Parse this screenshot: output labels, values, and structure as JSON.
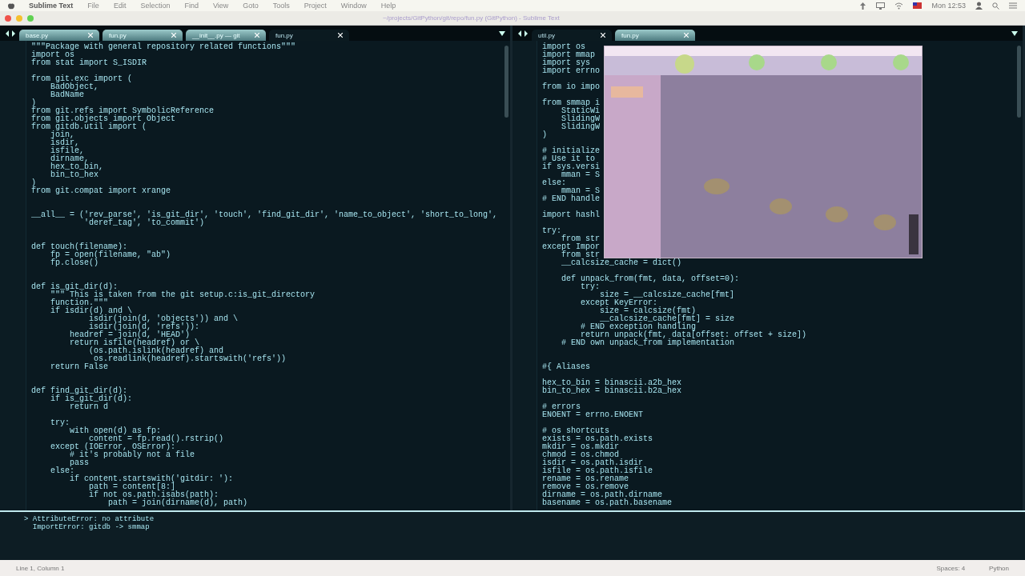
{
  "menu_bar": {
    "app_name": "Sublime Text",
    "menus": [
      "File",
      "Edit",
      "Selection",
      "Find",
      "View",
      "Goto",
      "Tools",
      "Project",
      "Window",
      "Help"
    ],
    "clock": "Mon 12:53"
  },
  "title_bar": {
    "title": "~/projects/GitPython/git/repo/fun.py (GitPython) - Sublime Text"
  },
  "left_pane": {
    "tabs": [
      {
        "label": "base.py",
        "selected": false
      },
      {
        "label": "fun.py",
        "selected": false
      },
      {
        "label": "__init__.py — git",
        "selected": false
      },
      {
        "label": "fun.py",
        "selected": true
      }
    ],
    "code": [
      {
        "kind": "flush",
        "lines": [
          "\"\"\"Package with general repository related functions\"\"\"",
          "import os",
          "from stat import S_ISDIR"
        ]
      },
      {
        "kind": "spaced",
        "lines": [
          "from git.exc import (",
          "    BadObject,",
          "    BadName",
          ")",
          "from git.refs import SymbolicReference",
          "from git.objects import Object",
          "from gitdb.util import (",
          "    join,",
          "    isdir,",
          "    isfile,",
          "    dirname,",
          "    hex_to_bin,",
          "    bin_to_hex",
          ")",
          "from git.compat import xrange"
        ]
      },
      {
        "kind": "wide",
        "lines": [
          "__all__ = ('rev_parse', 'is_git_dir', 'touch', 'find_git_dir', 'name_to_object', 'short_to_long',",
          "           'deref_tag', 'to_commit')"
        ]
      },
      {
        "kind": "wide",
        "lines": [
          "def touch(filename):",
          "    fp = open(filename, \"ab\")",
          "    fp.close()"
        ]
      },
      {
        "kind": "wide",
        "lines": [
          "def is_git_dir(d):",
          "    \"\"\" This is taken from the git setup.c:is_git_directory",
          "    function.\"\"\"",
          "    if isdir(d) and \\",
          "            isdir(join(d, 'objects')) and \\",
          "            isdir(join(d, 'refs')):",
          "        headref = join(d, 'HEAD')",
          "        return isfile(headref) or \\",
          "            (os.path.islink(headref) and",
          "             os.readlink(headref).startswith('refs'))",
          "    return False"
        ]
      },
      {
        "kind": "wide",
        "lines": [
          "def find_git_dir(d):",
          "    if is_git_dir(d):",
          "        return d"
        ]
      },
      {
        "kind": "spaced",
        "lines": [
          "    try:",
          "        with open(d) as fp:",
          "            content = fp.read().rstrip()",
          "    except (IOError, OSError):",
          "        # it's probably not a file",
          "        pass",
          "    else:",
          "        if content.startswith('gitdir: '):",
          "            path = content[8:]",
          "            if not os.path.isabs(path):",
          "                path = join(dirname(d), path)"
        ]
      }
    ]
  },
  "right_pane": {
    "tabs": [
      {
        "label": "util.py",
        "selected": true
      },
      {
        "label": "fun.py",
        "selected": false
      }
    ],
    "code": [
      {
        "kind": "flush",
        "lines": [
          "import os",
          "import mmap",
          "import sys",
          "import errno"
        ]
      },
      {
        "kind": "spaced",
        "lines": [
          "from io impo"
        ]
      },
      {
        "kind": "spaced",
        "lines": [
          "from smmap i",
          "    StaticWi",
          "    SlidingW",
          "    SlidingW",
          ")"
        ]
      },
      {
        "kind": "spaced",
        "lines": [
          "# initialize",
          "# Use it to",
          "if sys.versi",
          "    mman = S",
          "else:",
          "    mman = S",
          "# END handle"
        ]
      },
      {
        "kind": "spaced",
        "lines": [
          "import hashl"
        ]
      },
      {
        "kind": "spaced",
        "lines": [
          "try:",
          "    from str",
          "except Impor",
          "    from str",
          "    __calcsize_cache = dict()"
        ]
      },
      {
        "kind": "spaced",
        "lines": [
          "    def unpack_from(fmt, data, offset=0):",
          "        try:",
          "            size = __calcsize_cache[fmt]",
          "        except KeyError:",
          "            size = calcsize(fmt)",
          "            __calcsize_cache[fmt] = size",
          "        # END exception handling",
          "        return unpack(fmt, data[offset: offset + size])",
          "    # END own unpack_from implementation"
        ]
      },
      {
        "kind": "wide",
        "lines": [
          "#{ Aliases"
        ]
      },
      {
        "kind": "spaced",
        "lines": [
          "hex_to_bin = binascii.a2b_hex",
          "bin_to_hex = binascii.b2a_hex"
        ]
      },
      {
        "kind": "spaced",
        "lines": [
          "# errors",
          "ENOENT = errno.ENOENT"
        ]
      },
      {
        "kind": "spaced",
        "lines": [
          "# os shortcuts",
          "exists = os.path.exists",
          "mkdir = os.mkdir",
          "chmod = os.chmod",
          "isdir = os.path.isdir",
          "isfile = os.path.isfile",
          "rename = os.rename",
          "remove = os.remove",
          "dirname = os.path.dirname",
          "basename = os.path.basename"
        ]
      }
    ]
  },
  "console": {
    "lines": [
      "> AttributeError: no attribute",
      "  ImportError: gitdb -> smmap"
    ]
  },
  "status_bar": {
    "position": "Line 1, Column 1",
    "indent": "Spaces: 4",
    "syntax": "Python"
  }
}
